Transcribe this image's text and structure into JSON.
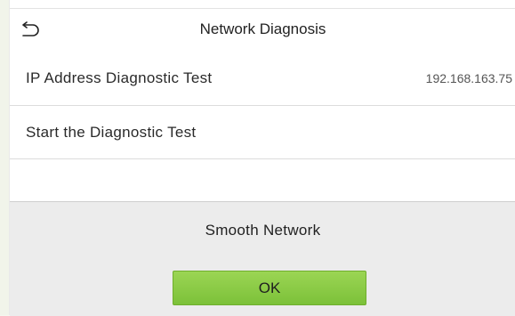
{
  "header": {
    "title": "Network Diagnosis",
    "back_icon": "back-arrow-icon"
  },
  "items": [
    {
      "label": "IP Address Diagnostic Test",
      "value": "192.168.163.75"
    },
    {
      "label": "Start the Diagnostic Test",
      "value": ""
    }
  ],
  "dialog": {
    "message": "Smooth Network",
    "ok_label": "OK"
  },
  "colors": {
    "button_green": "#8ccb46",
    "dialog_bg": "#ececec",
    "divider": "#dcdcdc"
  }
}
